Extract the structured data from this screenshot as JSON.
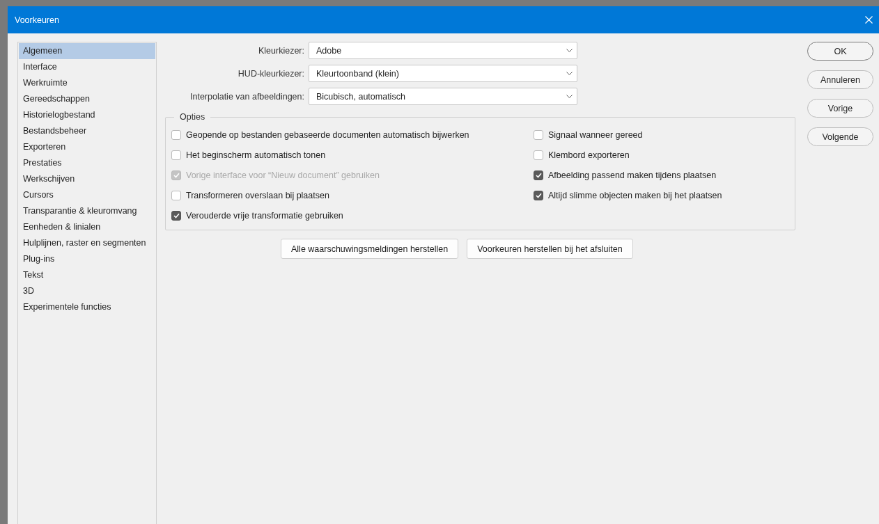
{
  "window": {
    "title": "Voorkeuren"
  },
  "sidebar": {
    "items": [
      {
        "label": "Algemeen",
        "selected": true
      },
      {
        "label": "Interface",
        "selected": false
      },
      {
        "label": "Werkruimte",
        "selected": false
      },
      {
        "label": "Gereedschappen",
        "selected": false
      },
      {
        "label": "Historielogbestand",
        "selected": false
      },
      {
        "label": "Bestandsbeheer",
        "selected": false
      },
      {
        "label": "Exporteren",
        "selected": false
      },
      {
        "label": "Prestaties",
        "selected": false
      },
      {
        "label": "Werkschijven",
        "selected": false
      },
      {
        "label": "Cursors",
        "selected": false
      },
      {
        "label": "Transparantie & kleuromvang",
        "selected": false
      },
      {
        "label": "Eenheden & linialen",
        "selected": false
      },
      {
        "label": "Hulplijnen, raster en segmenten",
        "selected": false
      },
      {
        "label": "Plug-ins",
        "selected": false
      },
      {
        "label": "Tekst",
        "selected": false
      },
      {
        "label": "3D",
        "selected": false
      },
      {
        "label": "Experimentele functies",
        "selected": false
      }
    ]
  },
  "fields": [
    {
      "label": "Kleurkiezer:",
      "value": "Adobe"
    },
    {
      "label": "HUD-kleurkiezer:",
      "value": "Kleurtoonband (klein)"
    },
    {
      "label": "Interpolatie van afbeeldingen:",
      "value": "Bicubisch, automatisch"
    }
  ],
  "options": {
    "title": "Opties",
    "left": [
      {
        "label": "Geopende op bestanden gebaseerde documenten automatisch bijwerken",
        "checked": false,
        "disabled": false
      },
      {
        "label": "Het beginscherm automatisch tonen",
        "checked": false,
        "disabled": false
      },
      {
        "label": "Vorige interface voor “Nieuw document” gebruiken",
        "checked": true,
        "disabled": true
      },
      {
        "label": "Transformeren overslaan bij plaatsen",
        "checked": false,
        "disabled": false
      },
      {
        "label": "Verouderde vrije transformatie gebruiken",
        "checked": true,
        "disabled": false
      }
    ],
    "right": [
      {
        "label": "Signaal wanneer gereed",
        "checked": false,
        "disabled": false
      },
      {
        "label": "Klembord exporteren",
        "checked": false,
        "disabled": false
      },
      {
        "label": "Afbeelding passend maken tijdens plaatsen",
        "checked": true,
        "disabled": false
      },
      {
        "label": "Altijd slimme objecten maken bij het plaatsen",
        "checked": true,
        "disabled": false
      }
    ]
  },
  "reset_buttons": [
    "Alle waarschuwingsmeldingen herstellen",
    "Voorkeuren herstellen bij het afsluiten"
  ],
  "dialog_buttons": [
    "OK",
    "Annuleren",
    "Vorige",
    "Volgende"
  ]
}
